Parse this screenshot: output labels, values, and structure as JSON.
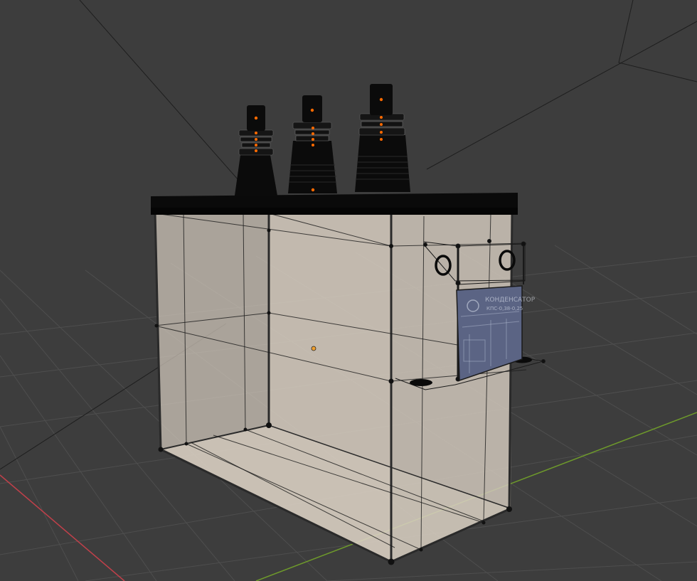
{
  "viewport": {
    "background": "#3d3d3d",
    "grid_color": "#4e4e4e",
    "x_axis_color": "#c0404a",
    "y_axis_color": "#6e9a2b"
  },
  "object": {
    "name": "capacitor",
    "body_color": "#d8cfc2",
    "lid_color": "#0a0a0a",
    "bushing_color": "#0b0b0b",
    "vertex_color": "#ff6a00",
    "origin_color": "#f0a030",
    "bushings_count": 3,
    "nameplate": {
      "line1": "КОНДЕНСАТОР",
      "line2": "КПС-0,38-0,25",
      "color": "#5b6484"
    },
    "lifting_rings": [
      "ring-left",
      "ring-right"
    ]
  }
}
